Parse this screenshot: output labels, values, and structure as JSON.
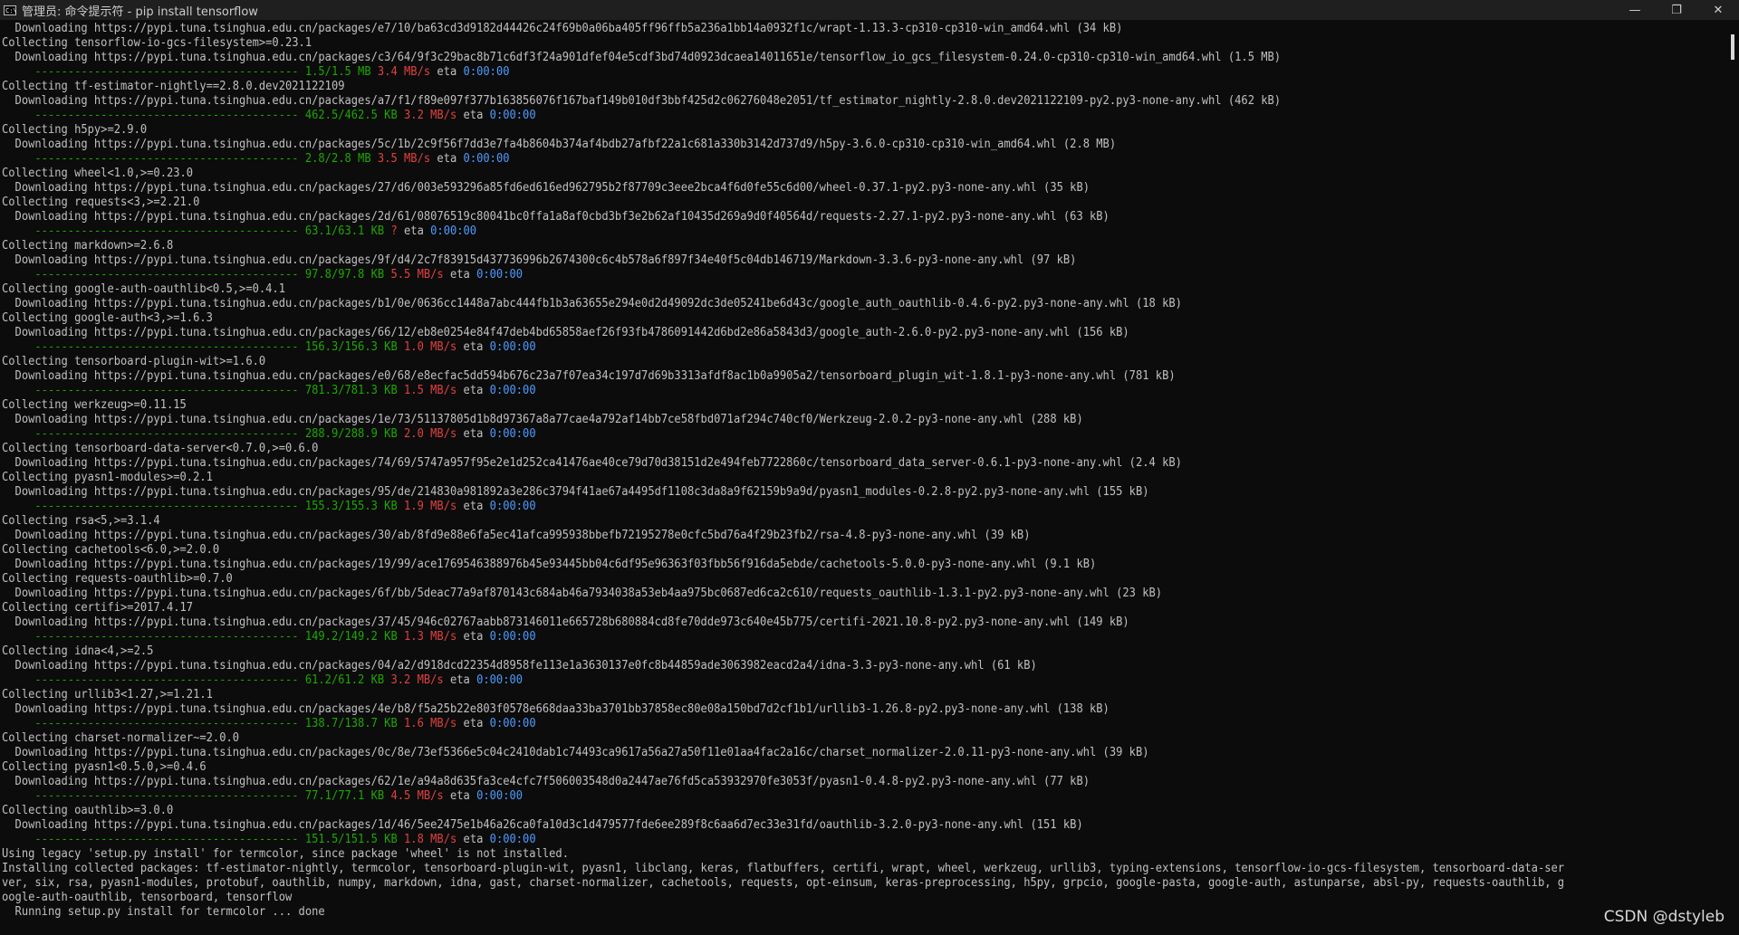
{
  "window": {
    "title": "管理员: 命令提示符 - pip  install tensorflow",
    "icon": "cmd-icon",
    "controls": {
      "minimize": "—",
      "maximize": "❐",
      "close": "✕"
    }
  },
  "terminal": {
    "colors": {
      "background": "#0c0c0c",
      "text": "#c0c0c0",
      "progress": "#1ca800",
      "speed": "#e04040",
      "eta": "#4d9bff"
    },
    "lines": [
      {
        "t": "text",
        "text": "  Downloading https://pypi.tuna.tsinghua.edu.cn/packages/e7/10/ba63cd3d9182d44426c24f69b0a06ba405ff96ffb5a236a1bb14a0932f1c/wrapt-1.13.3-cp310-cp310-win_amd64.whl (34 kB)"
      },
      {
        "t": "text",
        "text": "Collecting tensorflow-io-gcs-filesystem>=0.23.1"
      },
      {
        "t": "text",
        "text": "  Downloading https://pypi.tuna.tsinghua.edu.cn/packages/c3/64/9f3c29bac8b71c6df3f24a901dfef04e5cdf3bd74d0923dcaea14011651e/tensorflow_io_gcs_filesystem-0.24.0-cp310-cp310-win_amd64.whl (1.5 MB)"
      },
      {
        "t": "prog",
        "bar": "     ---------------------------------------- ",
        "size": "1.5/1.5 MB",
        "speed": "3.4 MB/s",
        "eta_label": "eta",
        "eta": "0:00:00"
      },
      {
        "t": "text",
        "text": "Collecting tf-estimator-nightly==2.8.0.dev2021122109"
      },
      {
        "t": "text",
        "text": "  Downloading https://pypi.tuna.tsinghua.edu.cn/packages/a7/f1/f89e097f377b163856076f167baf149b010df3bbf425d2c06276048e2051/tf_estimator_nightly-2.8.0.dev2021122109-py2.py3-none-any.whl (462 kB)"
      },
      {
        "t": "prog",
        "bar": "     ---------------------------------------- ",
        "size": "462.5/462.5 KB",
        "speed": "3.2 MB/s",
        "eta_label": "eta",
        "eta": "0:00:00"
      },
      {
        "t": "text",
        "text": "Collecting h5py>=2.9.0"
      },
      {
        "t": "text",
        "text": "  Downloading https://pypi.tuna.tsinghua.edu.cn/packages/5c/1b/2c9f56f7dd3e7fa4b8604b374af4bdb27afbf22a1c681a330b3142d737d9/h5py-3.6.0-cp310-cp310-win_amd64.whl (2.8 MB)"
      },
      {
        "t": "prog",
        "bar": "     ---------------------------------------- ",
        "size": "2.8/2.8 MB",
        "speed": "3.5 MB/s",
        "eta_label": "eta",
        "eta": "0:00:00"
      },
      {
        "t": "text",
        "text": "Collecting wheel<1.0,>=0.23.0"
      },
      {
        "t": "text",
        "text": "  Downloading https://pypi.tuna.tsinghua.edu.cn/packages/27/d6/003e593296a85fd6ed616ed962795b2f87709c3eee2bca4f6d0fe55c6d00/wheel-0.37.1-py2.py3-none-any.whl (35 kB)"
      },
      {
        "t": "text",
        "text": "Collecting requests<3,>=2.21.0"
      },
      {
        "t": "text",
        "text": "  Downloading https://pypi.tuna.tsinghua.edu.cn/packages/2d/61/08076519c80041bc0ffa1a8af0cbd3bf3e2b62af10435d269a9d0f40564d/requests-2.27.1-py2.py3-none-any.whl (63 kB)"
      },
      {
        "t": "prog",
        "bar": "     ---------------------------------------- ",
        "size": "63.1/63.1 KB",
        "speed": "?",
        "eta_label": "eta",
        "eta": "0:00:00"
      },
      {
        "t": "text",
        "text": "Collecting markdown>=2.6.8"
      },
      {
        "t": "text",
        "text": "  Downloading https://pypi.tuna.tsinghua.edu.cn/packages/9f/d4/2c7f83915d437736996b2674300c6c4b578a6f897f34e40f5c04db146719/Markdown-3.3.6-py3-none-any.whl (97 kB)"
      },
      {
        "t": "prog",
        "bar": "     ---------------------------------------- ",
        "size": "97.8/97.8 KB",
        "speed": "5.5 MB/s",
        "eta_label": "eta",
        "eta": "0:00:00"
      },
      {
        "t": "text",
        "text": "Collecting google-auth-oauthlib<0.5,>=0.4.1"
      },
      {
        "t": "text",
        "text": "  Downloading https://pypi.tuna.tsinghua.edu.cn/packages/b1/0e/0636cc1448a7abc444fb1b3a63655e294e0d2d49092dc3de05241be6d43c/google_auth_oauthlib-0.4.6-py2.py3-none-any.whl (18 kB)"
      },
      {
        "t": "text",
        "text": "Collecting google-auth<3,>=1.6.3"
      },
      {
        "t": "text",
        "text": "  Downloading https://pypi.tuna.tsinghua.edu.cn/packages/66/12/eb8e0254e84f47deb4bd65858aef26f93fb4786091442d6bd2e86a5843d3/google_auth-2.6.0-py2.py3-none-any.whl (156 kB)"
      },
      {
        "t": "prog",
        "bar": "     ---------------------------------------- ",
        "size": "156.3/156.3 KB",
        "speed": "1.0 MB/s",
        "eta_label": "eta",
        "eta": "0:00:00"
      },
      {
        "t": "text",
        "text": "Collecting tensorboard-plugin-wit>=1.6.0"
      },
      {
        "t": "text",
        "text": "  Downloading https://pypi.tuna.tsinghua.edu.cn/packages/e0/68/e8ecfac5dd594b676c23a7f07ea34c197d7d69b3313afdf8ac1b0a9905a2/tensorboard_plugin_wit-1.8.1-py3-none-any.whl (781 kB)"
      },
      {
        "t": "prog",
        "bar": "     ---------------------------------------- ",
        "size": "781.3/781.3 KB",
        "speed": "1.5 MB/s",
        "eta_label": "eta",
        "eta": "0:00:00"
      },
      {
        "t": "text",
        "text": "Collecting werkzeug>=0.11.15"
      },
      {
        "t": "text",
        "text": "  Downloading https://pypi.tuna.tsinghua.edu.cn/packages/1e/73/51137805d1b8d97367a8a77cae4a792af14bb7ce58fbd071af294c740cf0/Werkzeug-2.0.2-py3-none-any.whl (288 kB)"
      },
      {
        "t": "prog",
        "bar": "     ---------------------------------------- ",
        "size": "288.9/288.9 KB",
        "speed": "2.0 MB/s",
        "eta_label": "eta",
        "eta": "0:00:00"
      },
      {
        "t": "text",
        "text": "Collecting tensorboard-data-server<0.7.0,>=0.6.0"
      },
      {
        "t": "text",
        "text": "  Downloading https://pypi.tuna.tsinghua.edu.cn/packages/74/69/5747a957f95e2e1d252ca41476ae40ce79d70d38151d2e494feb7722860c/tensorboard_data_server-0.6.1-py3-none-any.whl (2.4 kB)"
      },
      {
        "t": "text",
        "text": "Collecting pyasn1-modules>=0.2.1"
      },
      {
        "t": "text",
        "text": "  Downloading https://pypi.tuna.tsinghua.edu.cn/packages/95/de/214830a981892a3e286c3794f41ae67a4495df1108c3da8a9f62159b9a9d/pyasn1_modules-0.2.8-py2.py3-none-any.whl (155 kB)"
      },
      {
        "t": "prog",
        "bar": "     ---------------------------------------- ",
        "size": "155.3/155.3 KB",
        "speed": "1.9 MB/s",
        "eta_label": "eta",
        "eta": "0:00:00"
      },
      {
        "t": "text",
        "text": "Collecting rsa<5,>=3.1.4"
      },
      {
        "t": "text",
        "text": "  Downloading https://pypi.tuna.tsinghua.edu.cn/packages/30/ab/8fd9e88e6fa5ec41afca995938bbefb72195278e0cfc5bd76a4f29b23fb2/rsa-4.8-py3-none-any.whl (39 kB)"
      },
      {
        "t": "text",
        "text": "Collecting cachetools<6.0,>=2.0.0"
      },
      {
        "t": "text",
        "text": "  Downloading https://pypi.tuna.tsinghua.edu.cn/packages/19/99/ace1769546388976b45e93445bb04c6df95e96363f03fbb56f916da5ebde/cachetools-5.0.0-py3-none-any.whl (9.1 kB)"
      },
      {
        "t": "text",
        "text": "Collecting requests-oauthlib>=0.7.0"
      },
      {
        "t": "text",
        "text": "  Downloading https://pypi.tuna.tsinghua.edu.cn/packages/6f/bb/5deac77a9af870143c684ab46a7934038a53eb4aa975bc0687ed6ca2c610/requests_oauthlib-1.3.1-py2.py3-none-any.whl (23 kB)"
      },
      {
        "t": "text",
        "text": "Collecting certifi>=2017.4.17"
      },
      {
        "t": "text",
        "text": "  Downloading https://pypi.tuna.tsinghua.edu.cn/packages/37/45/946c02767aabb873146011e665728b680884cd8fe70dde973c640e45b775/certifi-2021.10.8-py2.py3-none-any.whl (149 kB)"
      },
      {
        "t": "prog",
        "bar": "     ---------------------------------------- ",
        "size": "149.2/149.2 KB",
        "speed": "1.3 MB/s",
        "eta_label": "eta",
        "eta": "0:00:00"
      },
      {
        "t": "text",
        "text": "Collecting idna<4,>=2.5"
      },
      {
        "t": "text",
        "text": "  Downloading https://pypi.tuna.tsinghua.edu.cn/packages/04/a2/d918dcd22354d8958fe113e1a3630137e0fc8b44859ade3063982eacd2a4/idna-3.3-py3-none-any.whl (61 kB)"
      },
      {
        "t": "prog",
        "bar": "     ---------------------------------------- ",
        "size": "61.2/61.2 KB",
        "speed": "3.2 MB/s",
        "eta_label": "eta",
        "eta": "0:00:00"
      },
      {
        "t": "text",
        "text": "Collecting urllib3<1.27,>=1.21.1"
      },
      {
        "t": "text",
        "text": "  Downloading https://pypi.tuna.tsinghua.edu.cn/packages/4e/b8/f5a25b22e803f0578e668daa33ba3701bb37858ec80e08a150bd7d2cf1b1/urllib3-1.26.8-py2.py3-none-any.whl (138 kB)"
      },
      {
        "t": "prog",
        "bar": "     ---------------------------------------- ",
        "size": "138.7/138.7 KB",
        "speed": "1.6 MB/s",
        "eta_label": "eta",
        "eta": "0:00:00"
      },
      {
        "t": "text",
        "text": "Collecting charset-normalizer~=2.0.0"
      },
      {
        "t": "text",
        "text": "  Downloading https://pypi.tuna.tsinghua.edu.cn/packages/0c/8e/73ef5366e5c04c2410dab1c74493ca9617a56a27a50f11e01aa4fac2a16c/charset_normalizer-2.0.11-py3-none-any.whl (39 kB)"
      },
      {
        "t": "text",
        "text": "Collecting pyasn1<0.5.0,>=0.4.6"
      },
      {
        "t": "text",
        "text": "  Downloading https://pypi.tuna.tsinghua.edu.cn/packages/62/1e/a94a8d635fa3ce4cfc7f506003548d0a2447ae76fd5ca53932970fe3053f/pyasn1-0.4.8-py2.py3-none-any.whl (77 kB)"
      },
      {
        "t": "prog",
        "bar": "     ---------------------------------------- ",
        "size": "77.1/77.1 KB",
        "speed": "4.5 MB/s",
        "eta_label": "eta",
        "eta": "0:00:00"
      },
      {
        "t": "text",
        "text": "Collecting oauthlib>=3.0.0"
      },
      {
        "t": "text",
        "text": "  Downloading https://pypi.tuna.tsinghua.edu.cn/packages/1d/46/5ee2475e1b46a26ca0fa10d3c1d479577fde6ee289f8c6aa6d7ec33e31fd/oauthlib-3.2.0-py3-none-any.whl (151 kB)"
      },
      {
        "t": "prog",
        "bar": "     ---------------------------------------- ",
        "size": "151.5/151.5 KB",
        "speed": "1.8 MB/s",
        "eta_label": "eta",
        "eta": "0:00:00"
      },
      {
        "t": "text",
        "text": "Using legacy 'setup.py install' for termcolor, since package 'wheel' is not installed."
      },
      {
        "t": "text",
        "text": "Installing collected packages: tf-estimator-nightly, termcolor, tensorboard-plugin-wit, pyasn1, libclang, keras, flatbuffers, certifi, wrapt, wheel, werkzeug, urllib3, typing-extensions, tensorflow-io-gcs-filesystem, tensorboard-data-ser"
      },
      {
        "t": "text",
        "text": "ver, six, rsa, pyasn1-modules, protobuf, oauthlib, numpy, markdown, idna, gast, charset-normalizer, cachetools, requests, opt-einsum, keras-preprocessing, h5py, grpcio, google-pasta, google-auth, astunparse, absl-py, requests-oauthlib, g"
      },
      {
        "t": "text",
        "text": "oogle-auth-oauthlib, tensorboard, tensorflow"
      },
      {
        "t": "text",
        "text": "  Running setup.py install for termcolor ... done"
      }
    ]
  },
  "watermark": "CSDN @dstyleb"
}
